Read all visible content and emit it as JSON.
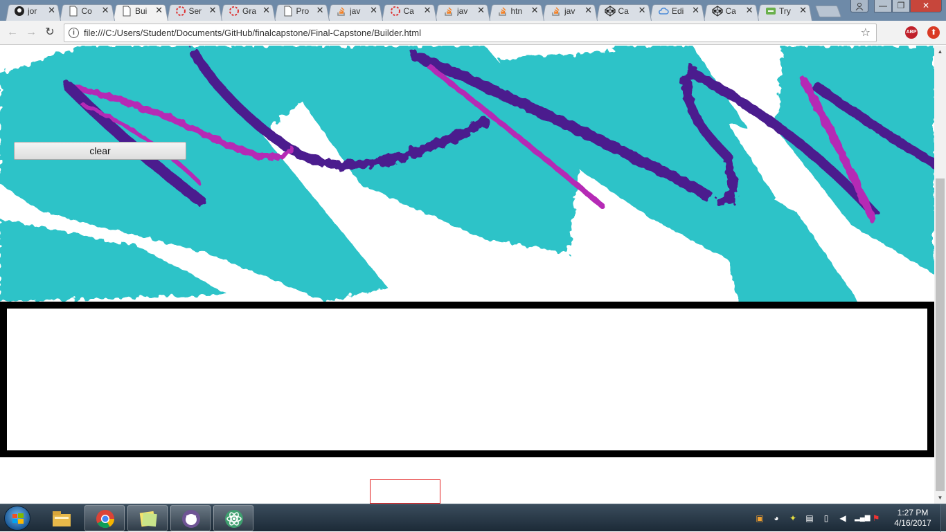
{
  "browser": {
    "tabs": [
      {
        "title": "jor",
        "icon": "github-icon",
        "active": false
      },
      {
        "title": "Co",
        "icon": "page-icon",
        "active": false
      },
      {
        "title": "Bui",
        "icon": "page-icon",
        "active": true
      },
      {
        "title": "Ser",
        "icon": "loading-icon",
        "active": false
      },
      {
        "title": "Gra",
        "icon": "loading-icon",
        "active": false
      },
      {
        "title": "Pro",
        "icon": "page-icon",
        "active": false
      },
      {
        "title": "jav",
        "icon": "stackoverflow-icon",
        "active": false
      },
      {
        "title": "Ca",
        "icon": "loading-icon",
        "active": false
      },
      {
        "title": "jav",
        "icon": "stackoverflow-icon",
        "active": false
      },
      {
        "title": "htn",
        "icon": "stackoverflow-icon",
        "active": false
      },
      {
        "title": "jav",
        "icon": "stackoverflow-icon",
        "active": false
      },
      {
        "title": "Ca",
        "icon": "codepen-icon",
        "active": false
      },
      {
        "title": "Edi",
        "icon": "cloud-icon",
        "active": false
      },
      {
        "title": "Ca",
        "icon": "codepen-icon",
        "active": false
      },
      {
        "title": "Try",
        "icon": "tryit-icon",
        "active": false
      }
    ],
    "close_glyph": "✕",
    "address": {
      "url": "file:///C:/Users/Student/Documents/GitHub/finalcapstone/Final-Capstone/Builder.html",
      "info_glyph": "i",
      "star_glyph": "☆"
    },
    "nav": {
      "back": "←",
      "forward": "→",
      "reload": "↻"
    },
    "extensions": {
      "adblock": "ABP",
      "upload": "⬆"
    },
    "window": {
      "minimize": "—",
      "maximize": "❐",
      "close": "✕"
    }
  },
  "page": {
    "clear_button": "clear",
    "colors": {
      "teal": "#21c0c6",
      "magenta": "#b52bb5",
      "purple": "#4b1c8e",
      "frame": "#000000",
      "red_box": "#e21b1b"
    }
  },
  "taskbar": {
    "apps": [
      {
        "name": "file-explorer-icon",
        "running": false
      },
      {
        "name": "chrome-icon",
        "running": true
      },
      {
        "name": "sticky-notes-icon",
        "running": true
      },
      {
        "name": "github-desktop-icon",
        "running": true
      },
      {
        "name": "atom-icon",
        "running": true
      }
    ],
    "clock": {
      "time": "1:27 PM",
      "date": "4/16/2017"
    }
  }
}
